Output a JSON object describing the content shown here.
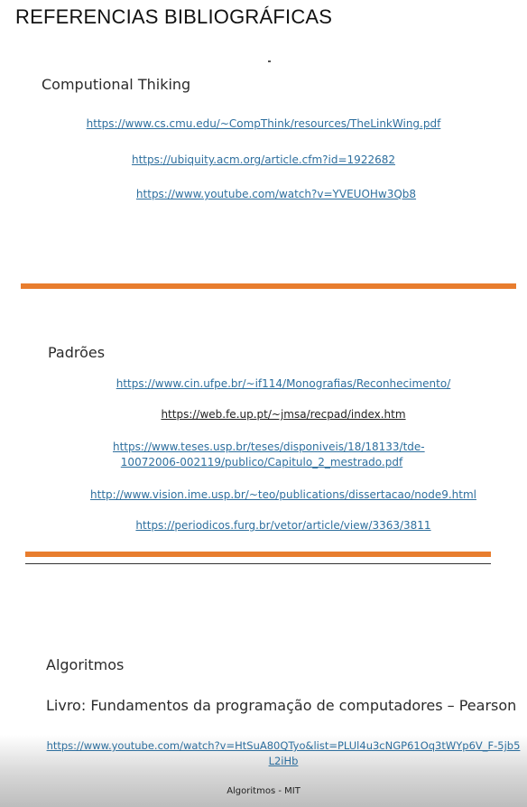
{
  "page_title": "REFERENCIAS BIBLIOGRÁFICAS",
  "sections": {
    "computational": {
      "heading": "Computional Thiking",
      "links": [
        "https://www.cs.cmu.edu/~CompThink/resources/TheLinkWing.pdf",
        "https://ubiquity.acm.org/article.cfm?id=1922682",
        "https://www.youtube.com/watch?v=YVEUOHw3Qb8"
      ]
    },
    "padroes": {
      "heading": "Padrões",
      "links": [
        "https://www.cin.ufpe.br/~if114/Monografias/Reconhecimento/",
        "https://web.fe.up.pt/~jmsa/recpad/index.htm",
        "https://www.teses.usp.br/teses/disponiveis/18/18133/tde-10072006-002119/publico/Capitulo_2_mestrado.pdf",
        "http://www.vision.ime.usp.br/~teo/publications/dissertacao/node9.html",
        "https://periodicos.furg.br/vetor/article/view/3363/3811"
      ]
    },
    "algoritmos": {
      "heading": "Algoritmos",
      "book": "Livro: Fundamentos da programação de computadores – Pearson",
      "link": "https://www.youtube.com/watch?v=HtSuA80QTyo&list=PLUl4u3cNGP61Oq3tWYp6V_F-5jb5L2iHb"
    }
  },
  "footer": "Algoritmos - MIT"
}
